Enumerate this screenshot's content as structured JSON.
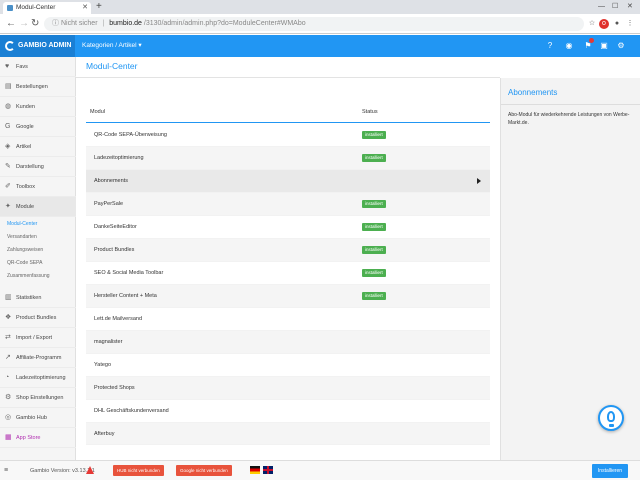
{
  "browser": {
    "tab_title": "Modul-Center",
    "new_tab_symbol": "+",
    "security_label": "Nicht sicher",
    "url_host": "bumbio.de",
    "url_path": "/3130/admin/admin.php?do=ModuleCenter#WMAbo"
  },
  "topbar": {
    "brand": "GAMBIO ADMIN",
    "breadcrumb": "Kategorien / Artikel ▾"
  },
  "sidebar": {
    "items": [
      {
        "label": "Favs",
        "icon": "heart-icon"
      },
      {
        "label": "Bestellungen",
        "icon": "cart-icon"
      },
      {
        "label": "Kunden",
        "icon": "users-icon"
      },
      {
        "label": "Google",
        "icon": "google-icon"
      },
      {
        "label": "Artikel",
        "icon": "tag-icon"
      },
      {
        "label": "Darstellung",
        "icon": "brush-icon"
      },
      {
        "label": "Toolbox",
        "icon": "wrench-icon"
      },
      {
        "label": "Module",
        "icon": "puzzle-icon"
      }
    ],
    "module_sub": [
      "Modul-Center",
      "Versandarten",
      "Zahlungsweisen",
      "QR-Code SEPA",
      "Zusammenfassung"
    ],
    "items_after": [
      {
        "label": "Statistiken",
        "icon": "chart-icon"
      },
      {
        "label": "Product Bundles",
        "icon": "bundle-icon"
      },
      {
        "label": "Import / Export",
        "icon": "exchange-icon"
      },
      {
        "label": "Affiliate-Programm",
        "icon": "link-icon"
      },
      {
        "label": "Ladezeitoptimierung",
        "icon": "speed-icon"
      },
      {
        "label": "Shop Einstellungen",
        "icon": "cog-icon"
      },
      {
        "label": "Gambio Hub",
        "icon": "hub-icon"
      },
      {
        "label": "App Store",
        "icon": "store-icon"
      }
    ]
  },
  "main": {
    "title": "Modul-Center",
    "col_module": "Modul",
    "col_status": "Status",
    "rows": [
      {
        "name": "QR-Code SEPA-Überweisung",
        "status": "installiert"
      },
      {
        "name": "Ladezeitoptimierung",
        "status": "installiert"
      },
      {
        "name": "Abonnements",
        "status": ""
      },
      {
        "name": "PayPerSale",
        "status": "installiert"
      },
      {
        "name": "DankeSeiteEditor",
        "status": "installiert"
      },
      {
        "name": "Product Bundles",
        "status": "installiert"
      },
      {
        "name": "SEO & Social Media Toolbar",
        "status": "installiert"
      },
      {
        "name": "Hersteller Content + Meta",
        "status": "installiert"
      },
      {
        "name": "Lett.de Mailversand",
        "status": ""
      },
      {
        "name": "magnalister",
        "status": ""
      },
      {
        "name": "Yatego",
        "status": ""
      },
      {
        "name": "Protected Shops",
        "status": ""
      },
      {
        "name": "DHL Geschäftskundenversand",
        "status": ""
      },
      {
        "name": "Afterbuy",
        "status": ""
      }
    ]
  },
  "right_panel": {
    "title": "Abonnements",
    "description": "Abo-Modul für wiederkehrende Leistungen von Werbe-Markt.de."
  },
  "footer": {
    "menu_symbol": "≡",
    "version": "Gambio Version: v3.13.1.1",
    "alert1": "HUB nicht verbunden",
    "alert2": "Google nicht verbunden",
    "install_button": "Installieren"
  },
  "colors": {
    "accent": "#2196f3",
    "installed": "#4caf50",
    "alert": "#e8533c",
    "app_store": "#b02fb0"
  }
}
